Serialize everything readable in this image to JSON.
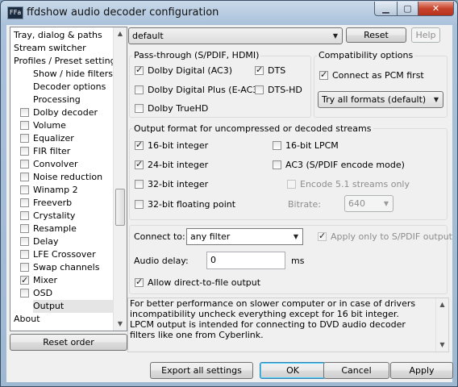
{
  "window": {
    "title": "ffdshow audio decoder configuration",
    "app_icon_text": "FFa",
    "min_glyph": "▁",
    "max_glyph": "▢",
    "close_glyph": "✕"
  },
  "sidebar": {
    "items": [
      {
        "label": "Tray, dialog & paths",
        "checkbox": false,
        "indent": 0
      },
      {
        "label": "Stream switcher",
        "checkbox": false,
        "indent": 0
      },
      {
        "label": "Profiles / Preset settings",
        "checkbox": false,
        "indent": 0
      },
      {
        "label": "Show / hide filters",
        "checkbox": false,
        "indent": 1
      },
      {
        "label": "Decoder options",
        "checkbox": false,
        "indent": 1
      },
      {
        "label": "Processing",
        "checkbox": false,
        "indent": 1
      },
      {
        "label": "Dolby decoder",
        "checkbox": true,
        "checked": false
      },
      {
        "label": "Volume",
        "checkbox": true,
        "checked": false
      },
      {
        "label": "Equalizer",
        "checkbox": true,
        "checked": false
      },
      {
        "label": "FIR filter",
        "checkbox": true,
        "checked": false
      },
      {
        "label": "Convolver",
        "checkbox": true,
        "checked": false
      },
      {
        "label": "Noise reduction",
        "checkbox": true,
        "checked": false
      },
      {
        "label": "Winamp 2",
        "checkbox": true,
        "checked": false
      },
      {
        "label": "Freeverb",
        "checkbox": true,
        "checked": false
      },
      {
        "label": "Crystality",
        "checkbox": true,
        "checked": false
      },
      {
        "label": "Resample",
        "checkbox": true,
        "checked": false
      },
      {
        "label": "Delay",
        "checkbox": true,
        "checked": false
      },
      {
        "label": "LFE Crossover",
        "checkbox": true,
        "checked": false
      },
      {
        "label": "Swap channels",
        "checkbox": true,
        "checked": false
      },
      {
        "label": "Mixer",
        "checkbox": true,
        "checked": true
      },
      {
        "label": "OSD",
        "checkbox": true,
        "checked": false
      },
      {
        "label": "Output",
        "checkbox": false,
        "indent": 1,
        "selected": true
      },
      {
        "label": "About",
        "checkbox": false,
        "indent": 0
      }
    ],
    "reset_order": "Reset order"
  },
  "preset": {
    "value": "default",
    "reset": "Reset",
    "help": "Help"
  },
  "passthrough": {
    "title": "Pass-through (S/PDIF, HDMI)",
    "ac3": {
      "label": "Dolby Digital (AC3)",
      "checked": true
    },
    "dts": {
      "label": "DTS",
      "checked": true
    },
    "eac3": {
      "label": "Dolby Digital Plus (E-AC3)",
      "checked": false
    },
    "dtshd": {
      "label": "DTS-HD",
      "checked": false
    },
    "truehd": {
      "label": "Dolby TrueHD",
      "checked": false
    }
  },
  "compat": {
    "title": "Compatibility options",
    "pcm": {
      "label": "Connect as PCM first",
      "checked": true
    },
    "formats": "Try all formats (default)"
  },
  "output": {
    "title": "Output format for uncompressed or decoded streams",
    "int16": {
      "label": "16-bit integer",
      "checked": true
    },
    "lpcm16": {
      "label": "16-bit LPCM",
      "checked": false
    },
    "int24": {
      "label": "24-bit integer",
      "checked": true
    },
    "ac3enc": {
      "label": "AC3 (S/PDIF encode mode)",
      "checked": false
    },
    "int32": {
      "label": "32-bit integer",
      "checked": false
    },
    "enc51": {
      "label": "Encode 5.1 streams only",
      "checked": false
    },
    "float32": {
      "label": "32-bit floating point",
      "checked": false
    },
    "bitrate_label": "Bitrate:",
    "bitrate_value": "640"
  },
  "connect": {
    "label": "Connect to:",
    "value": "any filter",
    "spdif_only": {
      "label": "Apply only to S/PDIF output",
      "checked": true
    },
    "delay_label": "Audio delay:",
    "delay_value": "0",
    "delay_unit": "ms",
    "direct_file": {
      "label": "Allow direct-to-file output",
      "checked": true
    }
  },
  "info": {
    "text": "For better performance on slower computer or in case of drivers incompatibility uncheck everything except for 16 bit integer.\nLPCM output is intended for connecting to DVD audio decoder filters like one from Cyberlink."
  },
  "footer": {
    "export": "Export all settings",
    "ok": "OK",
    "cancel": "Cancel",
    "apply": "Apply"
  },
  "icons": {
    "scroll_up": "▲",
    "scroll_down": "▼",
    "dropdown": "▼"
  }
}
